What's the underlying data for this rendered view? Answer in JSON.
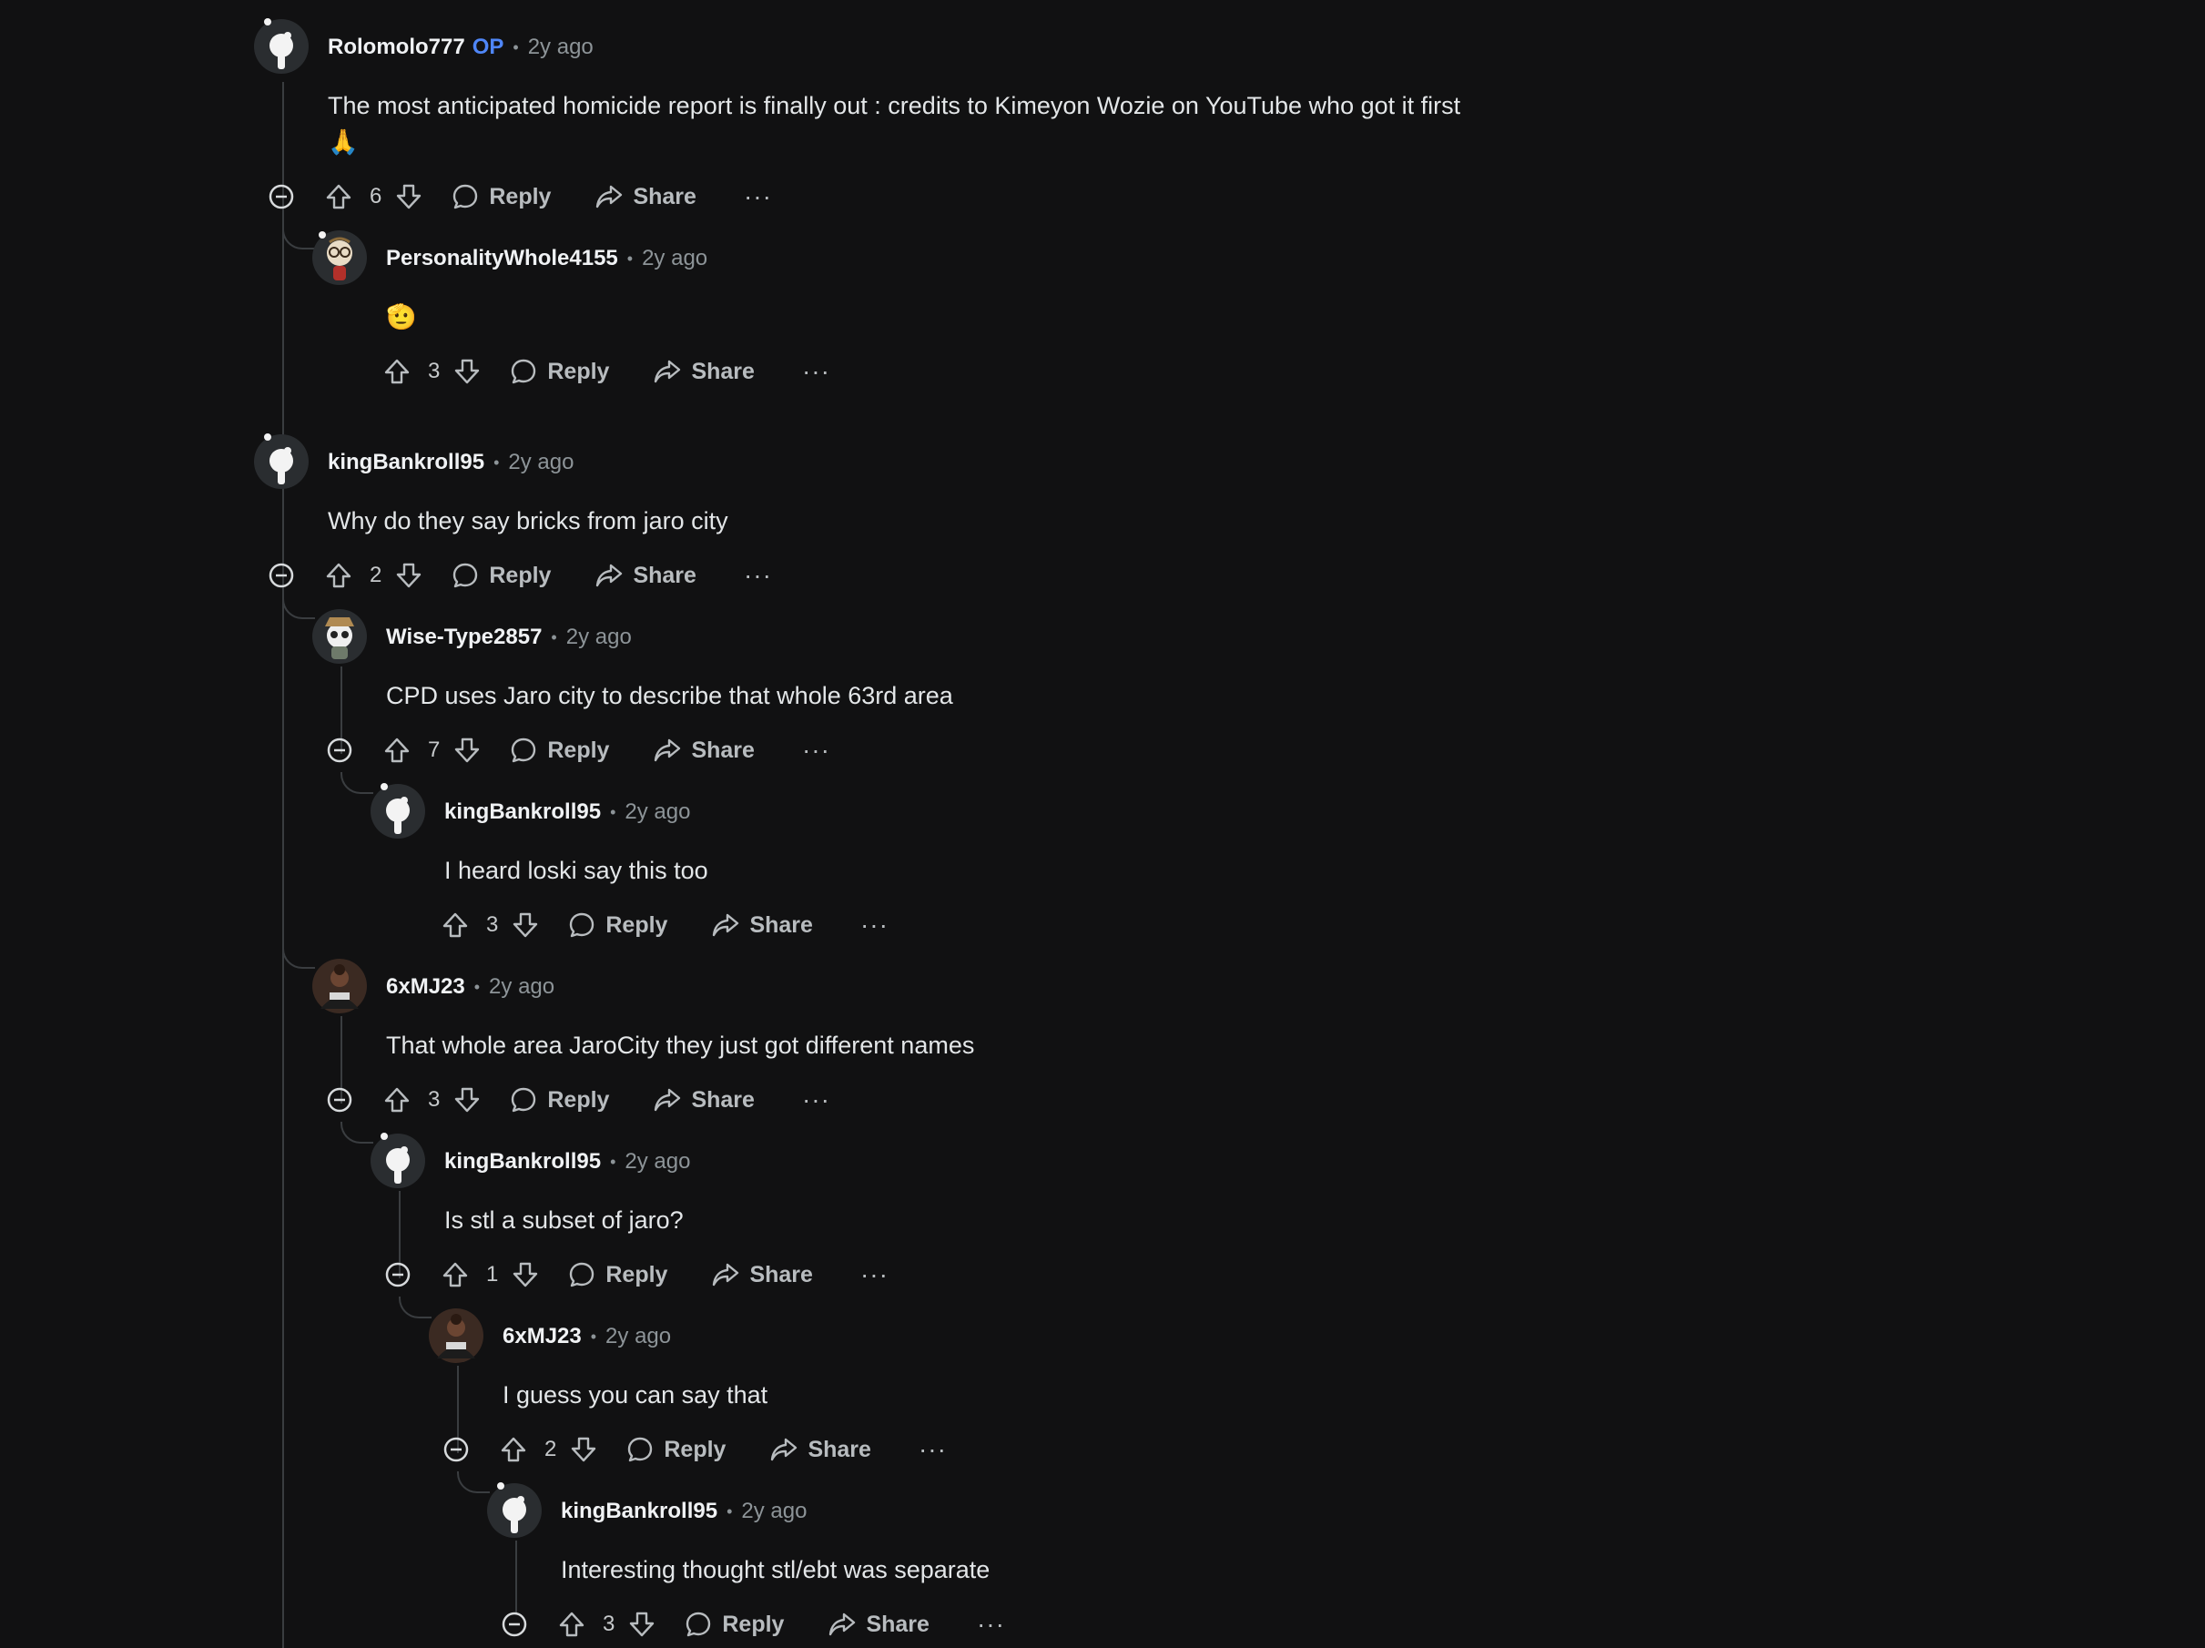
{
  "comments": [
    {
      "username": "Rolomolo777",
      "op_label": "OP",
      "time": "2y ago",
      "text": "The most anticipated homicide report is finally out : credits to Kimeyon Wozie on YouTube who got it first",
      "text_line2": "🙏",
      "votes": "6",
      "reply_label": "Reply",
      "share_label": "Share",
      "more_label": "···",
      "avatar": "snoo-avatar-default"
    },
    {
      "username": "PersonalityWhole4155",
      "time": "2y ago",
      "text": "🫡",
      "votes": "3",
      "reply_label": "Reply",
      "share_label": "Share",
      "more_label": "···",
      "avatar": "snoo-avatar-nerd"
    },
    {
      "username": "kingBankroll95",
      "time": "2y ago",
      "text": "Why do they say bricks from jaro city",
      "votes": "2",
      "reply_label": "Reply",
      "share_label": "Share",
      "more_label": "···",
      "avatar": "snoo-avatar-default"
    },
    {
      "username": "Wise-Type2857",
      "time": "2y ago",
      "text": "CPD uses Jaro city to describe that whole 63rd area",
      "votes": "7",
      "reply_label": "Reply",
      "share_label": "Share",
      "more_label": "···",
      "avatar": "snoo-avatar-hat"
    },
    {
      "username": "kingBankroll95",
      "time": "2y ago",
      "text": "I heard loski say this too",
      "votes": "3",
      "reply_label": "Reply",
      "share_label": "Share",
      "more_label": "···",
      "avatar": "snoo-avatar-default"
    },
    {
      "username": "6xMJ23",
      "time": "2y ago",
      "text": "That whole area JaroCity they just got different names",
      "votes": "3",
      "reply_label": "Reply",
      "share_label": "Share",
      "more_label": "···",
      "avatar": "photo-avatar"
    },
    {
      "username": "kingBankroll95",
      "time": "2y ago",
      "text": "Is stl a subset of jaro?",
      "votes": "1",
      "reply_label": "Reply",
      "share_label": "Share",
      "more_label": "···",
      "avatar": "snoo-avatar-default"
    },
    {
      "username": "6xMJ23",
      "time": "2y ago",
      "text": "I guess you can say that",
      "votes": "2",
      "reply_label": "Reply",
      "share_label": "Share",
      "more_label": "···",
      "avatar": "photo-avatar"
    },
    {
      "username": "kingBankroll95",
      "time": "2y ago",
      "text": "Interesting thought stl/ebt was separate",
      "votes": "3",
      "reply_label": "Reply",
      "share_label": "Share",
      "more_label": "···",
      "avatar": "snoo-avatar-default"
    }
  ],
  "icons": {
    "upvote": "upvote-icon",
    "downvote": "downvote-icon",
    "reply": "reply-bubble-icon",
    "share": "share-arrow-icon",
    "collapse": "collapse-minus-icon"
  },
  "colors": {
    "background": "#111112",
    "op": "#4f86f7",
    "thread_line": "#3a3d40"
  }
}
